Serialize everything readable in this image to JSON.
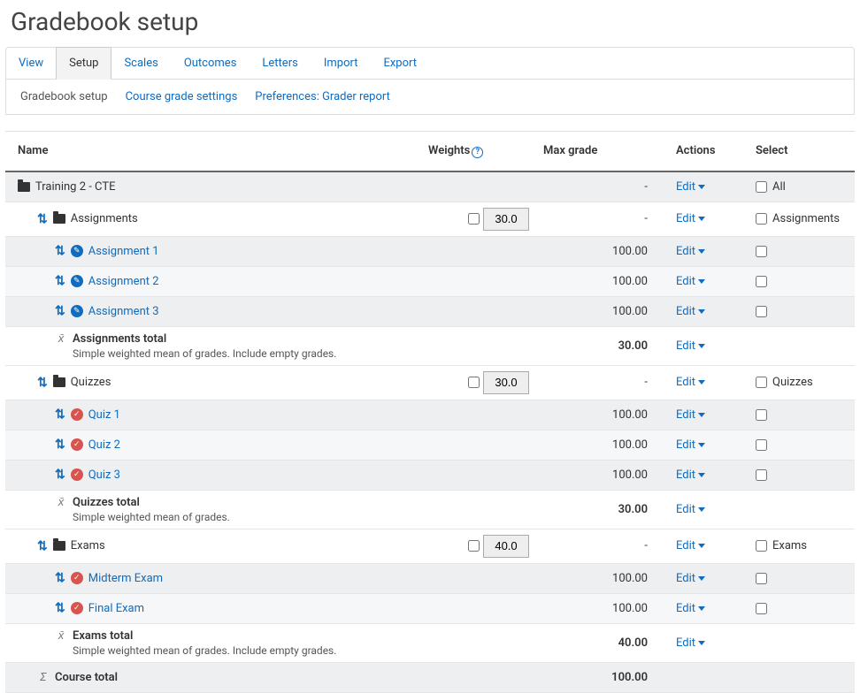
{
  "page_title": "Gradebook setup",
  "tabs_primary": {
    "items": [
      "View",
      "Setup",
      "Scales",
      "Outcomes",
      "Letters",
      "Import",
      "Export"
    ],
    "active": "Setup"
  },
  "tabs_secondary": {
    "items": [
      "Gradebook setup",
      "Course grade settings",
      "Preferences: Grader report"
    ],
    "active": "Gradebook setup"
  },
  "columns": {
    "name": "Name",
    "weights": "Weights",
    "maxgrade": "Max grade",
    "actions": "Actions",
    "select": "Select"
  },
  "edit_label": "Edit",
  "select_all_label": "All",
  "course": {
    "name": "Training 2 - CTE",
    "maxgrade": "-",
    "categories": [
      {
        "name": "Assignments",
        "weight": "30.0",
        "maxgrade": "-",
        "select_label": "Assignments",
        "items": [
          {
            "name": "Assignment 1",
            "maxgrade": "100.00",
            "type": "assign"
          },
          {
            "name": "Assignment 2",
            "maxgrade": "100.00",
            "type": "assign"
          },
          {
            "name": "Assignment 3",
            "maxgrade": "100.00",
            "type": "assign"
          }
        ],
        "total": {
          "label": "Assignments total",
          "note": "Simple weighted mean of grades. Include empty grades.",
          "maxgrade": "30.00"
        }
      },
      {
        "name": "Quizzes",
        "weight": "30.0",
        "maxgrade": "-",
        "select_label": "Quizzes",
        "items": [
          {
            "name": "Quiz 1",
            "maxgrade": "100.00",
            "type": "quiz"
          },
          {
            "name": "Quiz 2",
            "maxgrade": "100.00",
            "type": "quiz"
          },
          {
            "name": "Quiz 3",
            "maxgrade": "100.00",
            "type": "quiz"
          }
        ],
        "total": {
          "label": "Quizzes total",
          "note": "Simple weighted mean of grades.",
          "maxgrade": "30.00"
        }
      },
      {
        "name": "Exams",
        "weight": "40.0",
        "maxgrade": "-",
        "select_label": "Exams",
        "items": [
          {
            "name": "Midterm Exam",
            "maxgrade": "100.00",
            "type": "quiz"
          },
          {
            "name": "Final Exam",
            "maxgrade": "100.00",
            "type": "quiz"
          }
        ],
        "total": {
          "label": "Exams total",
          "note": "Simple weighted mean of grades. Include empty grades.",
          "maxgrade": "40.00"
        }
      }
    ],
    "course_total": {
      "label": "Course total",
      "maxgrade": "100.00"
    }
  }
}
